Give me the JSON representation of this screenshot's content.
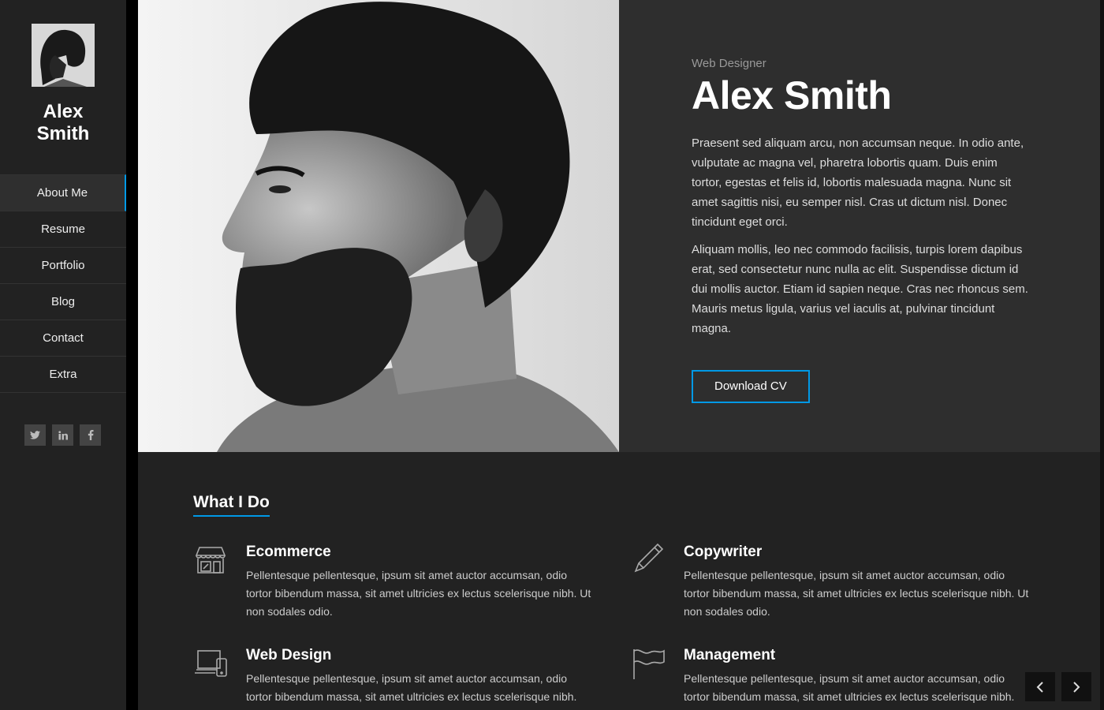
{
  "sidebar": {
    "name": "Alex\nSmith",
    "nav": [
      "About Me",
      "Resume",
      "Portfolio",
      "Blog",
      "Contact",
      "Extra"
    ],
    "active": "About Me",
    "socials": [
      "twitter-icon",
      "linkedin-icon",
      "facebook-icon"
    ]
  },
  "hero": {
    "role": "Web Designer",
    "name": "Alex Smith",
    "paragraphs": [
      "Praesent sed aliquam arcu, non accumsan neque. In odio ante, vulputate ac magna vel, pharetra lobortis quam. Duis enim tortor, egestas et felis id, lobortis malesuada magna. Nunc sit amet sagittis nisi, eu semper nisl. Cras ut dictum nisl. Donec tincidunt eget orci.",
      "Aliquam mollis, leo nec commodo facilisis, turpis lorem dapibus erat, sed consectetur nunc nulla ac elit. Suspendisse dictum id dui mollis auctor. Etiam id sapien neque. Cras nec rhoncus sem. Mauris metus ligula, varius vel iaculis at, pulvinar tincidunt magna."
    ],
    "cv_button": "Download CV"
  },
  "services": {
    "title": "What I Do",
    "items": [
      {
        "title": "Ecommerce",
        "icon": "store-icon",
        "desc": "Pellentesque pellentesque, ipsum sit amet auctor accumsan, odio tortor bibendum massa, sit amet ultricies ex lectus scelerisque nibh. Ut non sodales odio."
      },
      {
        "title": "Copywriter",
        "icon": "pencil-icon",
        "desc": "Pellentesque pellentesque, ipsum sit amet auctor accumsan, odio tortor bibendum massa, sit amet ultricies ex lectus scelerisque nibh. Ut non sodales odio."
      },
      {
        "title": "Web Design",
        "icon": "devices-icon",
        "desc": "Pellentesque pellentesque, ipsum sit amet auctor accumsan, odio tortor bibendum massa, sit amet ultricies ex lectus scelerisque nibh."
      },
      {
        "title": "Management",
        "icon": "flag-icon",
        "desc": "Pellentesque pellentesque, ipsum sit amet auctor accumsan, odio tortor bibendum massa, sit amet ultricies ex lectus scelerisque nibh."
      }
    ]
  },
  "colors": {
    "accent": "#0099e6",
    "sidebar": "#222222",
    "hero_panel": "#2e2e2e"
  }
}
